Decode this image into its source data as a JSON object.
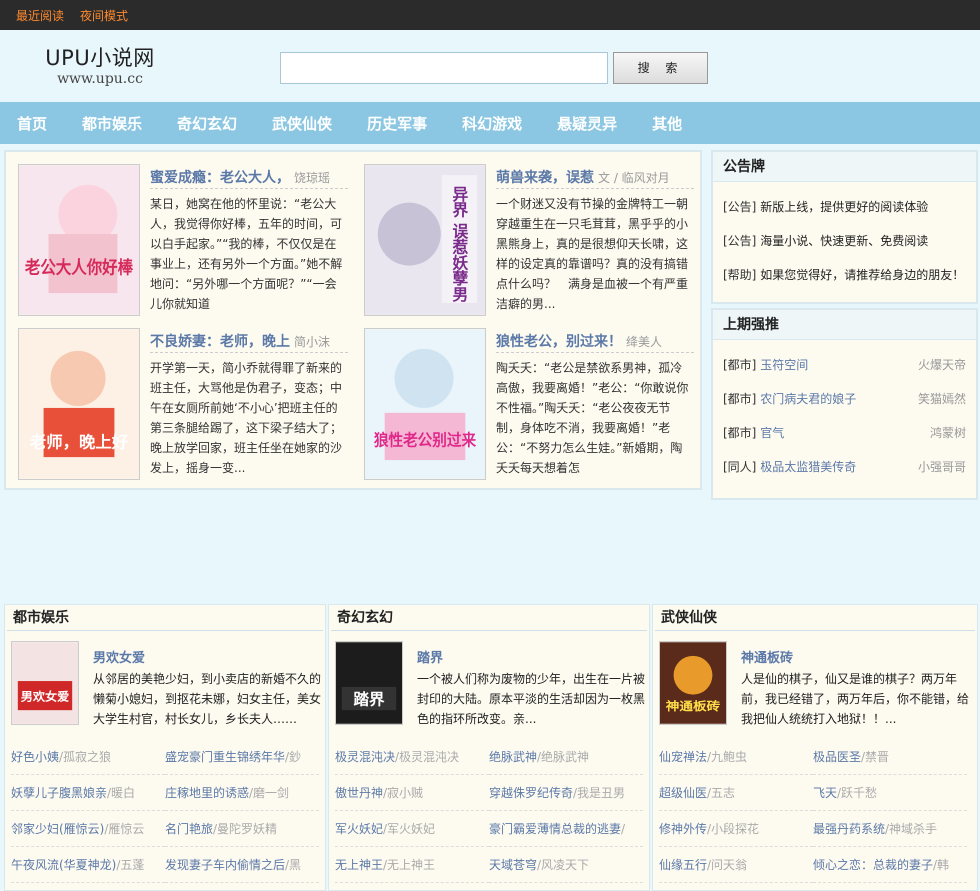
{
  "topbar": {
    "recent": "最近阅读",
    "night": "夜间模式"
  },
  "logo": {
    "name": "UPU小说网",
    "url": "www.upu.cc"
  },
  "search": {
    "placeholder": "",
    "button": "搜 索"
  },
  "nav": [
    "首页",
    "都市娱乐",
    "奇幻玄幻",
    "武侠仙侠",
    "历史军事",
    "科幻游戏",
    "悬疑灵异",
    "其他"
  ],
  "recommend": [
    {
      "title": "蜜爱成瘾：老公大人，",
      "author": "饶琼瑶",
      "desc": "某日，她窝在他的怀里说：“老公大人，我觉得你好棒，五年的时间，可以白手起家。”“我的棒，不仅仅是在事业上，还有另外一个方面。”她不解地问：“另外哪一个方面呢？”“一会儿你就知道",
      "cover_text": "老公大人你好棒"
    },
    {
      "title": "萌兽来袭，误惹",
      "author": "文 / 临风对月",
      "desc": "一个财迷又没有节操的金牌特工一朝穿越重生在一只毛茸茸，黑乎乎的小黑熊身上，真的是很想仰天长啸，这样的设定真的靠谱吗？真的没有搞错点什么吗？　满身是血被一个有严重洁癖的男...",
      "cover_text": "异界 误惹妖孽男"
    },
    {
      "title": "不良娇妻：老师，晚上",
      "author": "简小沫",
      "desc": "开学第一天，简小乔就得罪了新来的班主任，大骂他是伪君子，变态；中午在女厕所前她‘不小心’把班主任的第三条腿给踢了，这下梁子结大了；晚上放学回家，班主任坐在她家的沙发上，摇身一变...",
      "cover_text": "老师，晚上好"
    },
    {
      "title": "狼性老公，别过来！",
      "author": "绛美人",
      "desc": "陶夭夭：“老公是禁欲系男神，孤冷高傲，我要离婚！”老公：“你敢说你不性福。”陶夭夭：“老公夜夜无节制，身体吃不消，我要离婚！”老公：“不努力怎么生娃。”新婚期，陶夭夭每天想着怎",
      "cover_text": "狼性老公别过来"
    }
  ],
  "notice": {
    "title": "公告牌",
    "items": [
      {
        "tag": "[公告]",
        "text": "新版上线，提供更好的阅读体验"
      },
      {
        "tag": "[公告]",
        "text": "海量小说、快速更新、免费阅读"
      },
      {
        "tag": "[帮助]",
        "text": "如果您觉得好，请推荐给身边的朋友！"
      }
    ]
  },
  "lastweek": {
    "title": "上期强推",
    "items": [
      {
        "tag": "[都市]",
        "name": "玉符空间",
        "author": "火爆天帝"
      },
      {
        "tag": "[都市]",
        "name": "农门病夫君的娘子",
        "author": "笑猫嫣然"
      },
      {
        "tag": "[都市]",
        "name": "官气",
        "author": "鸿蒙树"
      },
      {
        "tag": "[同人]",
        "name": "极品太监猎美传奇",
        "author": "小强哥哥"
      }
    ]
  },
  "columns": [
    {
      "title": "都市娱乐",
      "featured": {
        "title": "男欢女爱",
        "desc": "从邻居的美艳少妇，到小卖店的新婚不久的懒菊小媳妇，到抠花未娜，妇女主任，美女大学生村官，村长女儿，乡长夫人……",
        "cover_text": "男欢女爱"
      },
      "list": [
        {
          "name": "好色小姨",
          "author": "/孤寂之狼"
        },
        {
          "name": "盛宠豪门重生锦绣年华",
          "author": "/鈔"
        },
        {
          "name": "妖孽儿子腹黑娘亲",
          "author": "/暖白"
        },
        {
          "name": "庄稼地里的诱惑",
          "author": "/磨一剑"
        },
        {
          "name": "邻家少妇(雁惊云)",
          "author": "/雁惊云"
        },
        {
          "name": "名门艳旅",
          "author": "/曼陀罗妖精"
        },
        {
          "name": "午夜风流(华夏神龙)",
          "author": "/五蓬"
        },
        {
          "name": "发现妻子车内偷情之后",
          "author": "/黑"
        }
      ]
    },
    {
      "title": "奇幻玄幻",
      "featured": {
        "title": "踏界",
        "desc": "一个被人们称为废物的少年，出生在一片被封印的大陆。原本平淡的生活却因为一枚黑色的指环所改变。亲...",
        "cover_text": "踏界"
      },
      "list": [
        {
          "name": "极灵混沌决",
          "author": "/极灵混沌决"
        },
        {
          "name": "绝脉武神",
          "author": "/绝脉武神"
        },
        {
          "name": "傲世丹神",
          "author": "/寂小贼"
        },
        {
          "name": "穿越侏罗纪传奇",
          "author": "/我是丑男"
        },
        {
          "name": "军火妖妃",
          "author": "/军火妖妃"
        },
        {
          "name": "豪门霸爱薄情总裁的逃妻",
          "author": "/"
        },
        {
          "name": "无上神王",
          "author": "/无上神王"
        },
        {
          "name": "天域苍穹",
          "author": "/风凌天下"
        }
      ]
    },
    {
      "title": "武侠仙侠",
      "featured": {
        "title": "神通板砖",
        "desc": "人是仙的棋子，仙又是谁的棋子？两万年前，我已经错了，两万年后，你不能错，给我把仙人统统打入地狱！！...",
        "cover_text": "神通板砖"
      },
      "list": [
        {
          "name": "仙宠禅法",
          "author": "/九鲍虫"
        },
        {
          "name": "极品医圣",
          "author": "/禁晋"
        },
        {
          "name": "超级仙医",
          "author": "/五志"
        },
        {
          "name": "飞天",
          "author": "/跃千愁"
        },
        {
          "name": "修神外传",
          "author": "/小段探花"
        },
        {
          "name": "最强丹药系统",
          "author": "/神域杀手"
        },
        {
          "name": "仙缘五行",
          "author": "/问天翁"
        },
        {
          "name": "倾心之恋：总裁的妻子",
          "author": "/韩"
        }
      ]
    }
  ],
  "colors": {
    "nav_bg": "#8bc7e2",
    "accent": "#ff8a2e",
    "link": "#5b79a8",
    "page_bg": "#e8f7fc"
  }
}
